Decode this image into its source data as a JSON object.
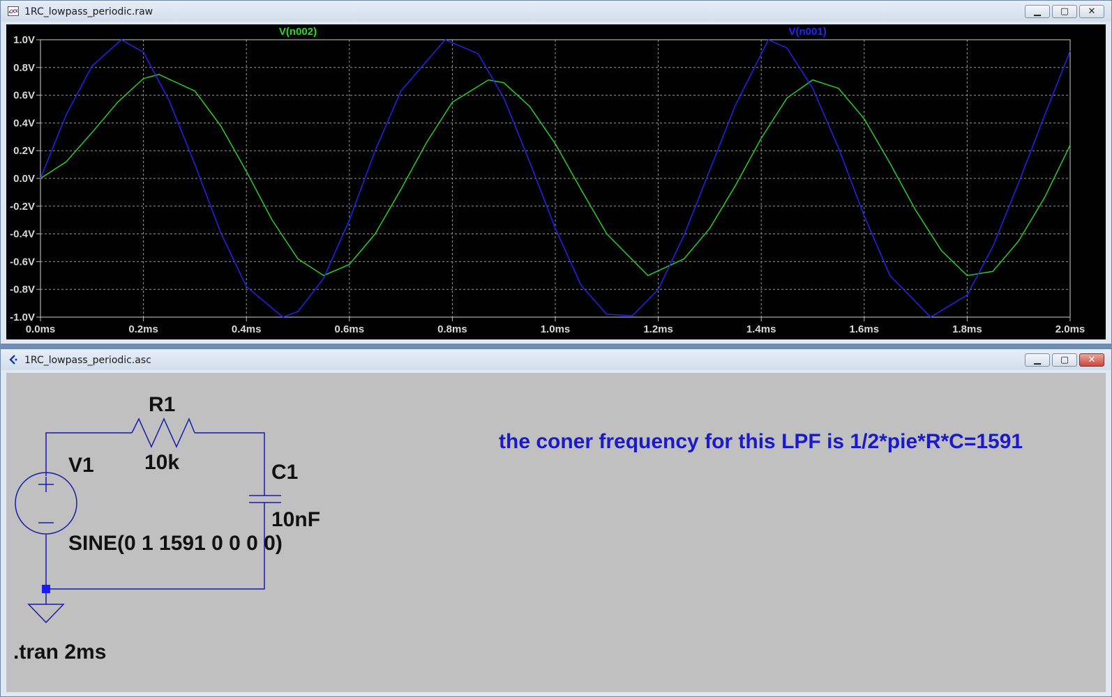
{
  "waveform_window": {
    "title": "1RC_lowpass_periodic.raw",
    "buttons": {
      "minimize": "▁",
      "maximize": "▢",
      "close": "✕"
    }
  },
  "schematic_window": {
    "title": "1RC_lowpass_periodic.asc",
    "buttons": {
      "minimize": "▁",
      "maximize": "▢",
      "close": "✕"
    }
  },
  "schematic": {
    "r1_name": "R1",
    "r1_value": "10k",
    "c1_name": "C1",
    "c1_value": "10nF",
    "v1_name": "V1",
    "v1_value": "SINE(0 1 1591 0 0 0 0)",
    "directive": ".tran 2ms",
    "comment": "the coner frequency for this LPF is 1/2*pie*R*C=1591",
    "comment_color": "#1a1acc",
    "wire_color": "#1a1aa8"
  },
  "chart_data": {
    "type": "line",
    "xlabel": "",
    "ylabel": "",
    "xlim": [
      0,
      2.0
    ],
    "ylim": [
      -1.0,
      1.0
    ],
    "x_unit": "ms",
    "y_unit": "V",
    "x_ticks": [
      "0.0ms",
      "0.2ms",
      "0.4ms",
      "0.6ms",
      "0.8ms",
      "1.0ms",
      "1.2ms",
      "1.4ms",
      "1.6ms",
      "1.8ms",
      "2.0ms"
    ],
    "y_ticks": [
      "1.0V",
      "0.8V",
      "0.6V",
      "0.4V",
      "0.2V",
      "0.0V",
      "-0.2V",
      "-0.4V",
      "-0.6V",
      "-0.8V",
      "-1.0V"
    ],
    "grid": true,
    "background": "#000000",
    "series": [
      {
        "name": "V(n002)",
        "color": "#22dd22",
        "label_position": "top-left",
        "x": [
          0,
          0.05,
          0.1,
          0.15,
          0.2,
          0.23,
          0.3,
          0.35,
          0.4,
          0.45,
          0.5,
          0.55,
          0.6,
          0.65,
          0.7,
          0.75,
          0.8,
          0.87,
          0.9,
          0.95,
          1.0,
          1.05,
          1.1,
          1.18,
          1.25,
          1.3,
          1.35,
          1.4,
          1.45,
          1.5,
          1.55,
          1.6,
          1.65,
          1.7,
          1.75,
          1.8,
          1.85,
          1.9,
          1.95,
          2.0
        ],
        "values": [
          0,
          0.12,
          0.33,
          0.55,
          0.72,
          0.75,
          0.63,
          0.38,
          0.05,
          -0.3,
          -0.58,
          -0.7,
          -0.62,
          -0.4,
          -0.08,
          0.26,
          0.55,
          0.71,
          0.69,
          0.52,
          0.25,
          -0.08,
          -0.4,
          -0.7,
          -0.58,
          -0.36,
          -0.05,
          0.29,
          0.58,
          0.71,
          0.65,
          0.43,
          0.11,
          -0.23,
          -0.52,
          -0.7,
          -0.67,
          -0.45,
          -0.14,
          0.24
        ]
      },
      {
        "name": "V(n001)",
        "color": "#2424ff",
        "label_position": "top-right",
        "x": [
          0,
          0.05,
          0.1,
          0.157,
          0.2,
          0.25,
          0.3,
          0.35,
          0.4,
          0.471,
          0.5,
          0.55,
          0.6,
          0.65,
          0.7,
          0.786,
          0.85,
          0.9,
          0.95,
          1.0,
          1.05,
          1.1,
          1.15,
          1.2,
          1.25,
          1.3,
          1.35,
          1.414,
          1.45,
          1.5,
          1.55,
          1.6,
          1.65,
          1.729,
          1.8,
          1.85,
          1.9,
          1.95,
          2.0
        ],
        "values": [
          0,
          0.46,
          0.81,
          1.0,
          0.91,
          0.56,
          0.1,
          -0.39,
          -0.78,
          -1.0,
          -0.96,
          -0.72,
          -0.3,
          0.2,
          0.63,
          1.0,
          0.9,
          0.58,
          0.12,
          -0.36,
          -0.77,
          -0.98,
          -0.99,
          -0.8,
          -0.41,
          0.06,
          0.53,
          1.0,
          0.94,
          0.65,
          0.22,
          -0.27,
          -0.7,
          -1.0,
          -0.84,
          -0.49,
          -0.03,
          0.45,
          0.92
        ]
      }
    ]
  }
}
